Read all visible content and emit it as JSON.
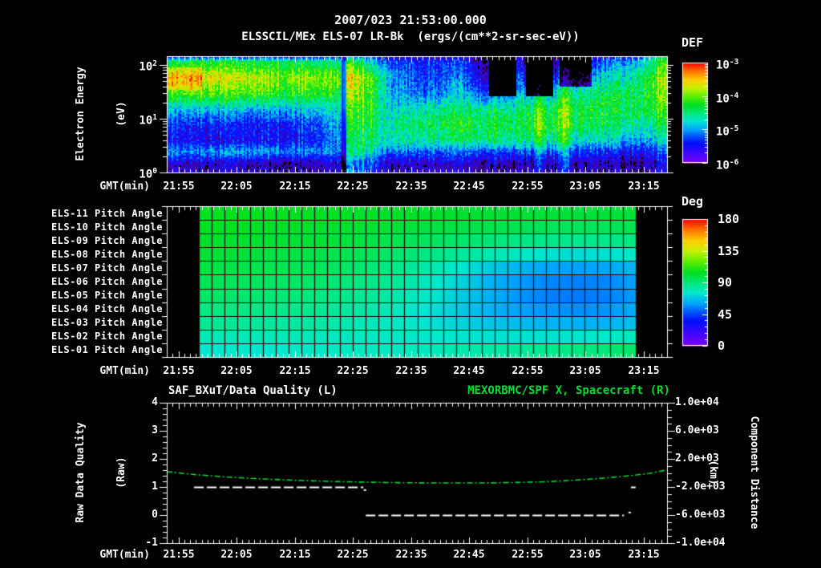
{
  "header": {
    "title": "2007/023 21:53:00.000",
    "subtitle": "ELSSCIL/MEx ELS-07 LR-Bk  (ergs/(cm**2-sr-sec-eV))"
  },
  "colors": {
    "background": "#000000",
    "text": "#ffffff",
    "accent_green": "#00dd33",
    "heatmap_grid": "#1b0a04"
  },
  "time_axis": {
    "axis_label": "GMT(min)",
    "tick_labels": [
      "21:55",
      "22:05",
      "22:15",
      "22:25",
      "22:35",
      "22:45",
      "22:55",
      "23:05",
      "23:15"
    ],
    "start": "21:53",
    "end": "23:19",
    "major_every_min": 10,
    "minor_every_min": 1,
    "first_label_offset_min": 2
  },
  "spectrogram_panel": {
    "ylabel_line1": "Electron Energy",
    "ylabel_line2": "(eV)",
    "ytick_base": "10",
    "ytick_exponents": [
      "2",
      "1",
      "0"
    ],
    "colorbar": {
      "title": "DEF",
      "tick_base": "10",
      "tick_exponents": [
        "-3",
        "-4",
        "-5",
        "-6"
      ]
    }
  },
  "pitch_panel": {
    "row_labels": [
      "ELS-11 Pitch Angle",
      "ELS-10 Pitch Angle",
      "ELS-09 Pitch Angle",
      "ELS-08 Pitch Angle",
      "ELS-07 Pitch Angle",
      "ELS-06 Pitch Angle",
      "ELS-05 Pitch Angle",
      "ELS-04 Pitch Angle",
      "ELS-03 Pitch Angle",
      "ELS-02 Pitch Angle",
      "ELS-01 Pitch Angle"
    ],
    "colorbar": {
      "title": "Deg",
      "tick_labels": [
        "180",
        "135",
        "90",
        "45",
        "0"
      ]
    }
  },
  "quality_panel": {
    "title_left": "SAF_BXuT/Data Quality (L)",
    "title_right": "MEXORBMC/SPF X, Spacecraft (R)",
    "ylabel_left_line1": "Raw Data Quality",
    "ylabel_left_line2": "(Raw)",
    "ylabel_right_line1": "Component Distance",
    "ylabel_right_line2": "(km)",
    "ytick_labels_left": [
      "4",
      "3",
      "2",
      "1",
      "0",
      "-1"
    ],
    "ytick_labels_right": [
      "1.0e+04",
      "6.0e+03",
      "2.0e+03",
      "-2.0e+03",
      "-6.0e+03",
      "-1.0e+04"
    ]
  },
  "chart_data": [
    {
      "type": "heatmap",
      "name": "electron-energy-spectrogram",
      "title": "ELSSCIL/MEx ELS-07 LR-Bk",
      "units": "ergs/(cm**2-sr-sec-eV)",
      "x_axis": {
        "label": "GMT(min)",
        "start": "21:53",
        "end": "23:19"
      },
      "y_axis": {
        "label": "Electron Energy (eV)",
        "scale": "log",
        "range_eV": [
          1,
          146
        ]
      },
      "colorbar": {
        "title": "DEF",
        "scale": "log",
        "range": [
          1e-06,
          0.001
        ]
      },
      "time_minutes_after_start": [
        0,
        5,
        10,
        15,
        20,
        25,
        30,
        35,
        40,
        45,
        50,
        55,
        60,
        65,
        70,
        75,
        80,
        86
      ],
      "energy_rows_eV": [
        160,
        120,
        60,
        30,
        15,
        8,
        4,
        2.5,
        1.5
      ],
      "log10_def_grid": [
        [
          -5.9,
          -5.8,
          -5.8,
          -5.9,
          -5.9,
          -5.9,
          -5.7,
          -5.8,
          -5.8,
          -5.8,
          -5.7,
          -6.1,
          -5.9,
          -6.2,
          -6.0,
          -5.7,
          -5.5,
          -4.9
        ],
        [
          -4.4,
          -4.3,
          -4.3,
          -4.4,
          -4.4,
          -4.5,
          -4.6,
          -5.1,
          -5.3,
          -5.4,
          -5.3,
          -5.9,
          -5.6,
          -6.1,
          -5.8,
          -5.3,
          -5.0,
          -4.5
        ],
        [
          -3.7,
          -3.6,
          -3.7,
          -3.8,
          -3.9,
          -3.9,
          -4.0,
          -4.4,
          -5.1,
          -5.3,
          -5.1,
          -5.7,
          -5.3,
          -5.8,
          -5.2,
          -4.8,
          -4.6,
          -4.2
        ],
        [
          -4.1,
          -4.0,
          -4.1,
          -4.1,
          -4.2,
          -4.2,
          -4.3,
          -4.5,
          -5.0,
          -5.1,
          -4.9,
          -5.2,
          -5.0,
          -4.9,
          -4.6,
          -4.4,
          -4.4,
          -4.3
        ],
        [
          -4.9,
          -4.9,
          -4.9,
          -5.0,
          -4.9,
          -4.9,
          -4.7,
          -4.6,
          -4.7,
          -4.6,
          -4.5,
          -4.5,
          -4.5,
          -4.4,
          -4.3,
          -4.3,
          -4.4,
          -4.5
        ],
        [
          -5.3,
          -5.4,
          -5.4,
          -5.5,
          -5.4,
          -5.3,
          -4.9,
          -4.7,
          -4.5,
          -4.4,
          -4.3,
          -4.3,
          -4.4,
          -4.3,
          -4.4,
          -4.4,
          -4.6,
          -4.8
        ],
        [
          -5.5,
          -5.5,
          -5.6,
          -5.5,
          -5.5,
          -5.4,
          -5.0,
          -4.8,
          -4.6,
          -4.6,
          -4.5,
          -4.5,
          -4.6,
          -4.6,
          -4.7,
          -4.8,
          -5.0,
          -5.2
        ],
        [
          -5.0,
          -5.0,
          -5.0,
          -5.0,
          -5.0,
          -5.1,
          -5.1,
          -5.0,
          -5.1,
          -5.2,
          -5.2,
          -5.3,
          -5.3,
          -5.3,
          -5.4,
          -5.4,
          -5.5,
          -5.6
        ],
        [
          -5.7,
          -5.7,
          -5.7,
          -5.8,
          -5.8,
          -5.8,
          -5.6,
          -5.6,
          -5.7,
          -5.7,
          -5.7,
          -5.8,
          -5.8,
          -5.8,
          -5.8,
          -5.8,
          -5.9,
          -5.9
        ]
      ],
      "data_gaps": [
        {
          "t0": 55.2,
          "t1": 60.0,
          "e_min": 28,
          "strength": 1.0
        },
        {
          "t0": 61.5,
          "t1": 66.3,
          "e_min": 28,
          "strength": 1.0
        },
        {
          "t0": 67.5,
          "t1": 73.0,
          "e_min": 40,
          "strength": 0.6
        },
        {
          "t0": 29.8,
          "t1": 30.7,
          "e_min": 1,
          "strength": 0.35
        }
      ],
      "bright_streaks": [
        {
          "t": 31.7,
          "width": 1.0,
          "boost": 0.55
        },
        {
          "t": 33.6,
          "width": 0.7,
          "boost": 0.45
        },
        {
          "t": 35.2,
          "width": 0.6,
          "boost": 0.35
        },
        {
          "t": 63.9,
          "width": 0.5,
          "boost": 0.6
        },
        {
          "t": 68.2,
          "width": 0.6,
          "boost": 0.7
        },
        {
          "t": 85.3,
          "width": 1.2,
          "boost": 0.5
        }
      ],
      "hotspots": [
        {
          "t0": 0,
          "t1": 6,
          "e0": 35,
          "e1": 95,
          "boost": 0.3
        }
      ]
    },
    {
      "type": "heatmap",
      "name": "pitch-angle-panels",
      "rows_order": "top_to_bottom",
      "rows": [
        "ELS-11",
        "ELS-10",
        "ELS-09",
        "ELS-08",
        "ELS-07",
        "ELS-06",
        "ELS-05",
        "ELS-04",
        "ELS-03",
        "ELS-02",
        "ELS-01"
      ],
      "colorbar": {
        "title": "Deg",
        "range": [
          0,
          180
        ]
      },
      "data_start_min": 5.5,
      "data_end_min": 80.7,
      "n_time_cells": 34,
      "pitch_angle_deg_grid": [
        [
          105,
          105,
          105,
          105,
          104,
          104,
          103,
          103,
          102,
          102,
          101,
          101,
          100,
          100,
          100,
          101
        ],
        [
          104,
          104,
          103,
          103,
          102,
          102,
          101,
          100,
          99,
          98,
          97,
          96,
          95,
          95,
          95,
          97
        ],
        [
          103,
          102,
          102,
          101,
          101,
          100,
          98,
          96,
          94,
          92,
          90,
          88,
          87,
          86,
          87,
          89
        ],
        [
          101,
          101,
          100,
          99,
          98,
          96,
          94,
          91,
          88,
          84,
          80,
          77,
          74,
          73,
          74,
          77
        ],
        [
          99,
          98,
          97,
          96,
          95,
          93,
          90,
          86,
          81,
          75,
          69,
          64,
          61,
          60,
          61,
          65
        ],
        [
          96,
          95,
          94,
          93,
          92,
          90,
          87,
          83,
          77,
          71,
          64,
          59,
          56,
          55,
          56,
          60
        ],
        [
          93,
          92,
          91,
          90,
          89,
          87,
          84,
          80,
          75,
          69,
          63,
          58,
          55,
          54,
          55,
          59
        ],
        [
          89,
          89,
          88,
          87,
          86,
          84,
          82,
          78,
          74,
          69,
          64,
          60,
          58,
          57,
          58,
          62
        ],
        [
          85,
          85,
          84,
          83,
          83,
          81,
          79,
          77,
          74,
          71,
          68,
          66,
          64,
          63,
          64,
          67
        ],
        [
          80,
          80,
          80,
          80,
          79,
          79,
          78,
          77,
          76,
          75,
          74,
          74,
          74,
          75,
          76,
          79
        ],
        [
          76,
          76,
          76,
          76,
          77,
          77,
          78,
          78,
          79,
          81,
          82,
          84,
          86,
          88,
          90,
          93
        ]
      ]
    },
    {
      "type": "line",
      "name": "quality-and-distance",
      "ylim_left": [
        -1,
        4
      ],
      "ylim_right": [
        -10000,
        10000
      ],
      "series": [
        {
          "name": "SAF_BXuT/Data Quality (L)",
          "axis": "left",
          "color": "#ffffff",
          "line_style": "dashed",
          "segments": [
            {
              "value": 1,
              "t0": 4.7,
              "t1": 33.8
            },
            {
              "value": 0,
              "t0": 34.2,
              "t1": 78.6
            },
            {
              "value": 1,
              "t0": 79.8,
              "t1": 80.6
            }
          ],
          "point_markers": [
            [
              34.0,
              0.89
            ],
            [
              79.5,
              0.09
            ]
          ]
        },
        {
          "name": "MEXORBMC/SPF X, Spacecraft (R)",
          "axis": "right",
          "color": "#00dd33",
          "line_style": "dash-dot",
          "points_t_km": [
            [
              0,
              180
            ],
            [
              5,
              -250
            ],
            [
              10,
              -560
            ],
            [
              15,
              -800
            ],
            [
              20,
              -980
            ],
            [
              25,
              -1130
            ],
            [
              30,
              -1250
            ],
            [
              35,
              -1330
            ],
            [
              40,
              -1390
            ],
            [
              45,
              -1420
            ],
            [
              50,
              -1430
            ],
            [
              55,
              -1420
            ],
            [
              60,
              -1360
            ],
            [
              65,
              -1260
            ],
            [
              70,
              -1050
            ],
            [
              75,
              -750
            ],
            [
              80,
              -360
            ],
            [
              83,
              -50
            ],
            [
              86,
              430
            ]
          ]
        }
      ]
    }
  ]
}
